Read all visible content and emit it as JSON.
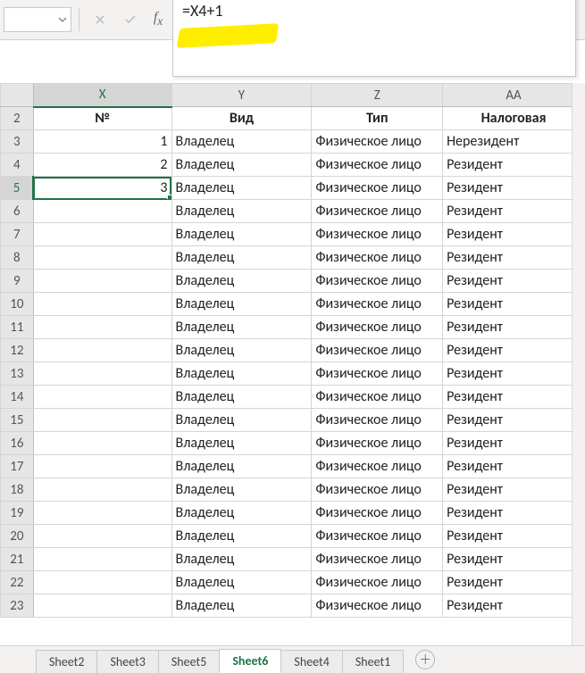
{
  "formula_bar": {
    "formula": "=X4+1"
  },
  "columns": [
    "X",
    "Y",
    "Z",
    "AA"
  ],
  "headers": {
    "X": "№",
    "Y": "Вид",
    "Z": "Тип",
    "AA": "Налоговая"
  },
  "rows": [
    {
      "n": 2,
      "X": "№",
      "Y": "Вид",
      "Z": "Тип",
      "AA": "Налоговая",
      "isHeader": true
    },
    {
      "n": 3,
      "X": "1",
      "Y": "Владелец",
      "Z": "Физическое лицо",
      "AA": "Нерезидент"
    },
    {
      "n": 4,
      "X": "2",
      "Y": "Владелец",
      "Z": "Физическое лицо",
      "AA": "Резидент"
    },
    {
      "n": 5,
      "X": "3",
      "Y": "Владелец",
      "Z": "Физическое лицо",
      "AA": "Резидент",
      "selected": true
    },
    {
      "n": 6,
      "X": "",
      "Y": "Владелец",
      "Z": "Физическое лицо",
      "AA": "Резидент"
    },
    {
      "n": 7,
      "X": "",
      "Y": "Владелец",
      "Z": "Физическое лицо",
      "AA": "Резидент"
    },
    {
      "n": 8,
      "X": "",
      "Y": "Владелец",
      "Z": "Физическое лицо",
      "AA": "Резидент"
    },
    {
      "n": 9,
      "X": "",
      "Y": "Владелец",
      "Z": "Физическое лицо",
      "AA": "Резидент"
    },
    {
      "n": 10,
      "X": "",
      "Y": "Владелец",
      "Z": "Физическое лицо",
      "AA": "Резидент"
    },
    {
      "n": 11,
      "X": "",
      "Y": "Владелец",
      "Z": "Физическое лицо",
      "AA": "Резидент"
    },
    {
      "n": 12,
      "X": "",
      "Y": "Владелец",
      "Z": "Физическое лицо",
      "AA": "Резидент"
    },
    {
      "n": 13,
      "X": "",
      "Y": "Владелец",
      "Z": "Физическое лицо",
      "AA": "Резидент"
    },
    {
      "n": 14,
      "X": "",
      "Y": "Владелец",
      "Z": "Физическое лицо",
      "AA": "Резидент"
    },
    {
      "n": 15,
      "X": "",
      "Y": "Владелец",
      "Z": "Физическое лицо",
      "AA": "Резидент"
    },
    {
      "n": 16,
      "X": "",
      "Y": "Владелец",
      "Z": "Физическое лицо",
      "AA": "Резидент"
    },
    {
      "n": 17,
      "X": "",
      "Y": "Владелец",
      "Z": "Физическое лицо",
      "AA": "Резидент"
    },
    {
      "n": 18,
      "X": "",
      "Y": "Владелец",
      "Z": "Физическое лицо",
      "AA": "Резидент"
    },
    {
      "n": 19,
      "X": "",
      "Y": "Владелец",
      "Z": "Физическое лицо",
      "AA": "Резидент"
    },
    {
      "n": 20,
      "X": "",
      "Y": "Владелец",
      "Z": "Физическое лицо",
      "AA": "Резидент"
    },
    {
      "n": 21,
      "X": "",
      "Y": "Владелец",
      "Z": "Физическое лицо",
      "AA": "Резидент"
    },
    {
      "n": 22,
      "X": "",
      "Y": "Владелец",
      "Z": "Физическое лицо",
      "AA": "Резидент"
    },
    {
      "n": 23,
      "X": "",
      "Y": "Владелец",
      "Z": "Физическое лицо",
      "AA": "Резидент"
    }
  ],
  "selected": {
    "row": 5,
    "col": "X"
  },
  "tabs": [
    {
      "label": "Sheet2",
      "active": false
    },
    {
      "label": "Sheet3",
      "active": false
    },
    {
      "label": "Sheet5",
      "active": false
    },
    {
      "label": "Sheet6",
      "active": true
    },
    {
      "label": "Sheet4",
      "active": false
    },
    {
      "label": "Sheet1",
      "active": false
    }
  ]
}
